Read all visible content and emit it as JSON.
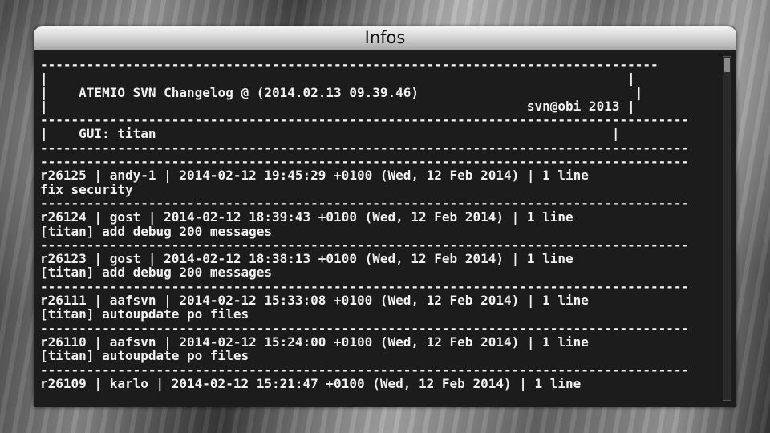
{
  "window": {
    "title": "Infos"
  },
  "changelog": {
    "lines": [
      "--------------------------------------------------------------------------------",
      "|                                                                           |",
      "|    ATEMIO SVN Changelog @ (2014.02.13 09.39.46)                            |",
      "|                                                              svn@obi 2013 |",
      "------------------------------------------------------------------------------------",
      "|    GUI: titan                                                           |",
      "------------------------------------------------------------------------------------",
      "------------------------------------------------------------------------------------",
      "r26125 | andy-1 | 2014-02-12 19:45:29 +0100 (Wed, 12 Feb 2014) | 1 line",
      "fix security",
      "------------------------------------------------------------------------------------",
      "r26124 | gost | 2014-02-12 18:39:43 +0100 (Wed, 12 Feb 2014) | 1 line",
      "[titan] add debug 200 messages",
      "------------------------------------------------------------------------------------",
      "r26123 | gost | 2014-02-12 18:38:13 +0100 (Wed, 12 Feb 2014) | 1 line",
      "[titan] add debug 200 messages",
      "------------------------------------------------------------------------------------",
      "r26111 | aafsvn | 2014-02-12 15:33:08 +0100 (Wed, 12 Feb 2014) | 1 line",
      "[titan] autoupdate po files",
      "------------------------------------------------------------------------------------",
      "r26110 | aafsvn | 2014-02-12 15:24:00 +0100 (Wed, 12 Feb 2014) | 1 line",
      "[titan] autoupdate po files",
      "------------------------------------------------------------------------------------",
      "r26109 | karlo | 2014-02-12 15:21:47 +0100 (Wed, 12 Feb 2014) | 1 line"
    ]
  },
  "colors": {
    "panel_background": "#1c1c1c",
    "text": "#f2f2f2",
    "scroll_thumb": "#8a8a8a"
  }
}
